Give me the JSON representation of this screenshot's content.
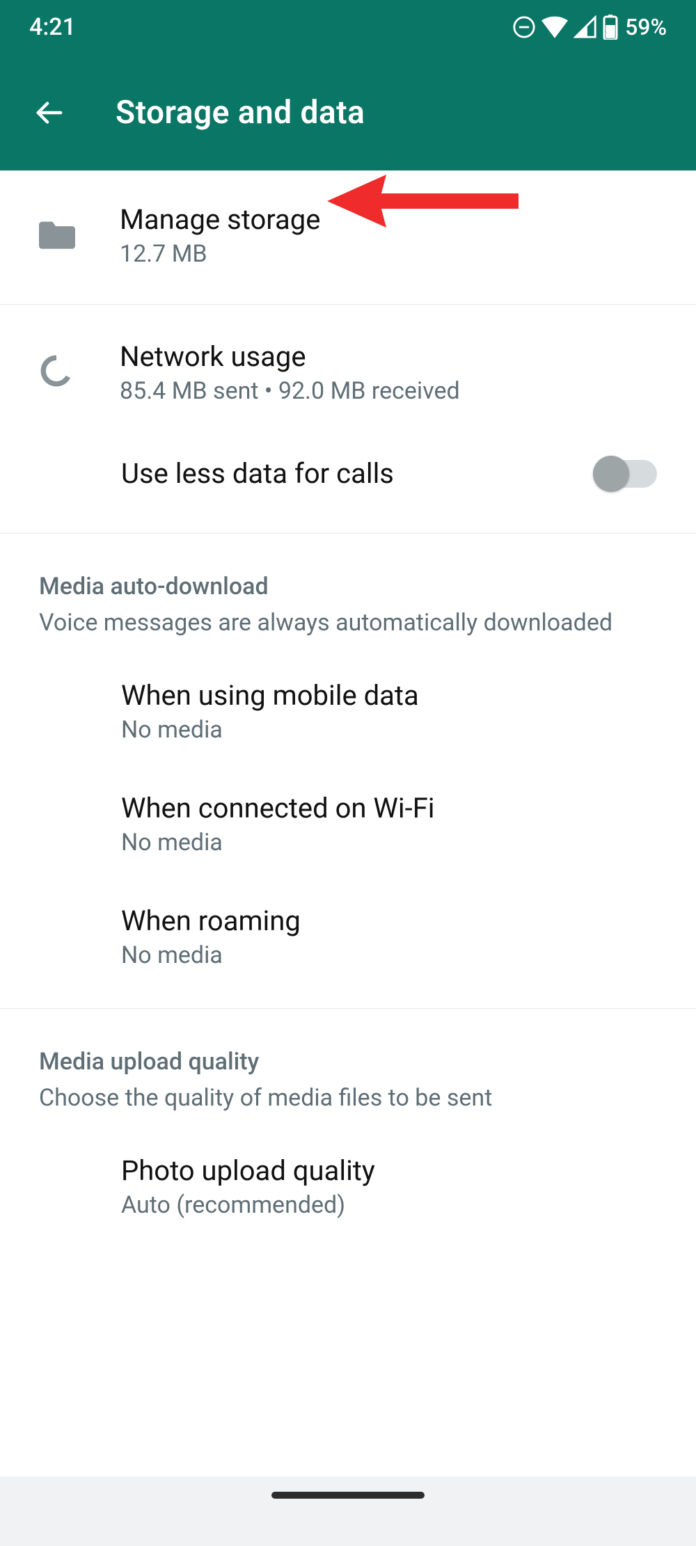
{
  "status": {
    "time": "4:21",
    "battery_pct": "59%"
  },
  "appbar": {
    "title": "Storage and data"
  },
  "rows": {
    "manage_storage": {
      "title": "Manage storage",
      "subtitle": "12.7 MB"
    },
    "network_usage": {
      "title": "Network usage",
      "subtitle": "85.4 MB sent • 92.0 MB received"
    },
    "use_less_data": {
      "title": "Use less data for calls",
      "toggle_on": false
    },
    "mobile_data": {
      "title": "When using mobile data",
      "subtitle": "No media"
    },
    "wifi": {
      "title": "When connected on Wi-Fi",
      "subtitle": "No media"
    },
    "roaming": {
      "title": "When roaming",
      "subtitle": "No media"
    },
    "photo_quality": {
      "title": "Photo upload quality",
      "subtitle": "Auto (recommended)"
    }
  },
  "sections": {
    "media_auto_download": {
      "title": "Media auto-download",
      "subtitle": "Voice messages are always automatically downloaded"
    },
    "media_upload_quality": {
      "title": "Media upload quality",
      "subtitle": "Choose the quality of media files to be sent"
    }
  }
}
